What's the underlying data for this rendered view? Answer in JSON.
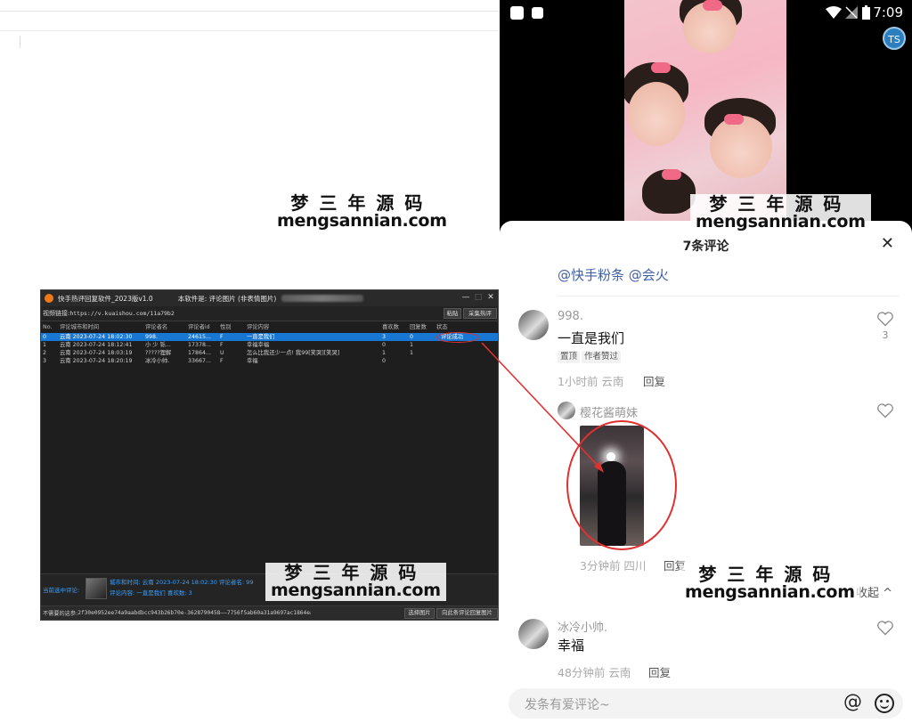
{
  "watermark": {
    "cn": "梦三年源码",
    "en": "mengsannian.com"
  },
  "tool": {
    "title": "快手热评回复软件_2023版v1.0",
    "note": "本软件是: 评论图片 (非表情图片)",
    "url_label": "视频链接:",
    "url_value": "https://v.kuaishou.com/11a79b2",
    "paste_button": "粘贴",
    "collect_button": "采集热评",
    "columns": [
      "No.",
      "评论城市和时间",
      "评论者名",
      "评论者id",
      "性别",
      "评论内容",
      "喜欢数",
      "回复数",
      "状态"
    ],
    "rows": [
      [
        "0",
        "云南 2023-07-24 18:02:30",
        "998.",
        "24615...",
        "F",
        "一直是我们",
        "3",
        "0",
        "评论成功"
      ],
      [
        "1",
        "云南 2023-07-24 18:12:41",
        "小 少 铄...",
        "17378...",
        "F",
        "幸福幸福",
        "0",
        "1",
        ""
      ],
      [
        "2",
        "云南 2023-07-24 18:03:19",
        "?????狸解",
        "17864...",
        "U",
        "怎么比我还少一点! 我99[笑哭][笑哭]",
        "1",
        "1",
        ""
      ],
      [
        "3",
        "云南 2023-07-24 18:20:19",
        "冰冷小帅.",
        "33667...",
        "F",
        "幸福",
        "0",
        "",
        ""
      ]
    ],
    "current_label": "当前选中评论:",
    "detail_line1": "城市和时间: 云南 2023-07-24 18:02:30 评论者名: 99",
    "detail_line2": "评论内容: 一直是我们    喜欢数: 3",
    "status_label": "不需要的这参:",
    "status_value": "2f30e0952ee74a9aabdbcc943b26b70e-3628790458——7756f5ab60a31a9697ac1864ea0b45b——A8EF755E-A0A7-4D",
    "select_image_button": "选择图片",
    "reply_button": "向此条评论回复图片"
  },
  "phone": {
    "time": "7:09",
    "ts_badge": "TS",
    "sheet_title": "7条评论",
    "close": "✕",
    "mention": "@快手粉条 @会火",
    "comments": [
      {
        "name": "998.",
        "text": "一直是我们",
        "tags": [
          "置顶",
          "作者赞过"
        ],
        "meta": "1小时前 云南",
        "reply": "回复",
        "likes": "3"
      },
      {
        "name": "樱花酱萌妹",
        "meta": "3分钟前 四川",
        "reply": "回复"
      },
      {
        "name": "冰冷小帅.",
        "text": "幸福",
        "meta": "48分钟前 云南",
        "reply": "回复"
      }
    ],
    "collapse": "收起 ^",
    "input_placeholder": "发条有爱评论~",
    "at_symbol": "@"
  },
  "colors": {
    "accent_blue": "#1877d2",
    "annotation_red": "#e03030",
    "mention_blue": "#3f5fa8"
  }
}
